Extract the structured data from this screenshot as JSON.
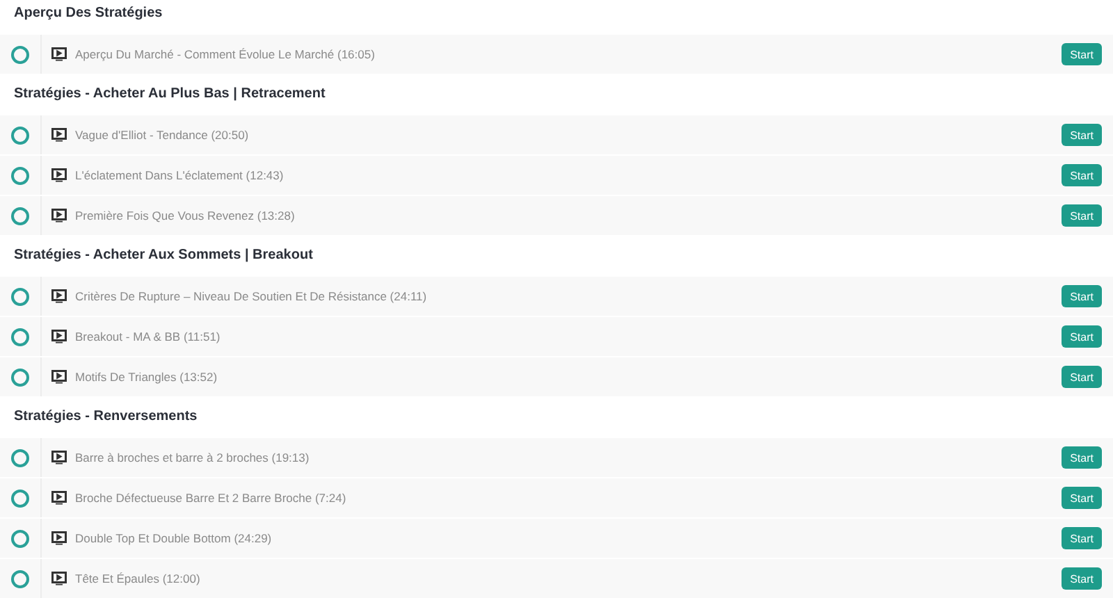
{
  "sections": [
    {
      "title": "Aperçu Des Stratégies",
      "lessons": [
        {
          "title": "Aperçu Du Marché - Comment Évolue Le Marché (16:05)",
          "completed": false,
          "button": "Start"
        }
      ]
    },
    {
      "title": "Stratégies - Acheter Au Plus Bas | Retracement",
      "lessons": [
        {
          "title": "Vague d'Elliot - Tendance (20:50)",
          "completed": false,
          "button": "Start"
        },
        {
          "title": "L'éclatement Dans L'éclatement (12:43)",
          "completed": false,
          "button": "Start"
        },
        {
          "title": "Première Fois Que Vous Revenez (13:28)",
          "completed": false,
          "button": "Start"
        }
      ]
    },
    {
      "title": "Stratégies - Acheter Aux Sommets | Breakout",
      "lessons": [
        {
          "title": "Critères De Rupture – Niveau De Soutien Et De Résistance (24:11)",
          "completed": false,
          "button": "Start"
        },
        {
          "title": "Breakout - MA & BB (11:51)",
          "completed": false,
          "button": "Start"
        },
        {
          "title": "Motifs De Triangles (13:52)",
          "completed": false,
          "button": "Start"
        }
      ]
    },
    {
      "title": "Stratégies - Renversements",
      "lessons": [
        {
          "title": "Barre à broches et barre à 2 broches (19:13)",
          "completed": false,
          "button": "Start"
        },
        {
          "title": "Broche Défectueuse Barre Et 2 Barre Broche (7:24)",
          "completed": false,
          "button": "Start"
        },
        {
          "title": "Double Top Et Double Bottom (24:29)",
          "completed": false,
          "button": "Start"
        },
        {
          "title": "Tête Et Épaules (12:00)",
          "completed": false,
          "button": "Start"
        }
      ]
    }
  ]
}
